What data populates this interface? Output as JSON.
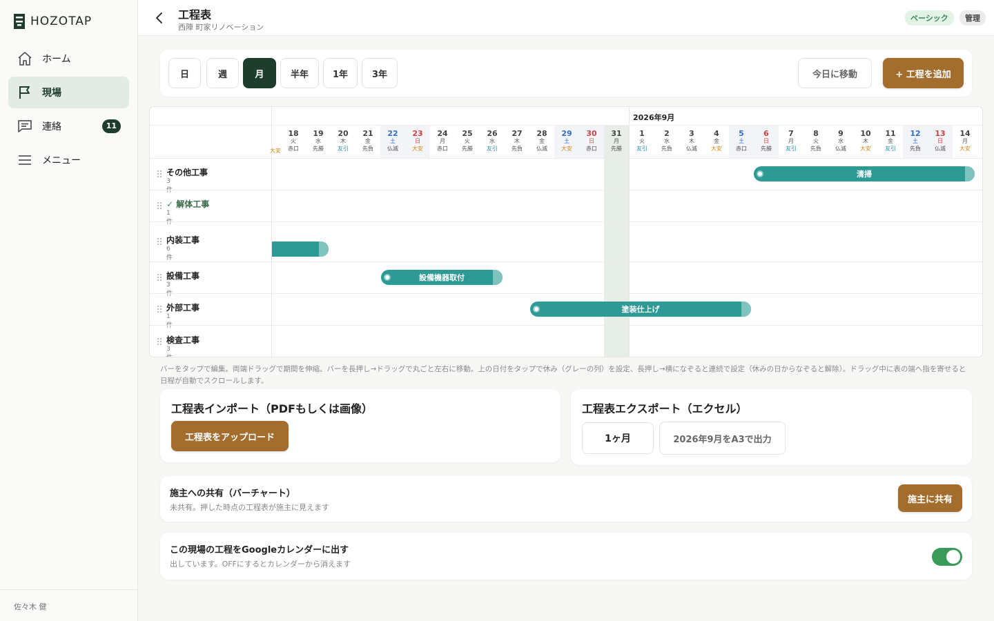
{
  "app": {
    "name": "HOZOTAP"
  },
  "colors": {
    "accent": "#1f3d2c",
    "brand_button": "#a36d2d",
    "bar": "#2e9a95",
    "toggle_on": "#3a9a5a"
  },
  "sidebar": {
    "items": [
      {
        "label": "ホーム",
        "icon": "home-icon",
        "active": false
      },
      {
        "label": "現場",
        "icon": "flag-icon",
        "active": true
      },
      {
        "label": "連絡",
        "icon": "chat-icon",
        "active": false,
        "badge": "11"
      },
      {
        "label": "メニュー",
        "icon": "menu-icon",
        "active": false
      }
    ],
    "user": "佐々木 健"
  },
  "header": {
    "title": "工程表",
    "subtitle": "西陣 町家リノベーション",
    "plan_badge": "ベーシック",
    "role_badge": "管理"
  },
  "toolbar": {
    "ranges": [
      "日",
      "週",
      "月",
      "半年",
      "1年",
      "3年"
    ],
    "selected_range": "月",
    "today_label": "今日に移動",
    "add_label": "+ 工程を追加"
  },
  "gantt": {
    "month_label": "2026年9月",
    "partial_first_rokuyo": "大安",
    "days": [
      {
        "d": "18",
        "wd": "火",
        "rk": "赤口"
      },
      {
        "d": "19",
        "wd": "水",
        "rk": "先勝"
      },
      {
        "d": "20",
        "wd": "木",
        "rk": "友引"
      },
      {
        "d": "21",
        "wd": "金",
        "rk": "先負"
      },
      {
        "d": "22",
        "wd": "土",
        "rk": "仏滅"
      },
      {
        "d": "23",
        "wd": "日",
        "rk": "大安"
      },
      {
        "d": "24",
        "wd": "月",
        "rk": "赤口"
      },
      {
        "d": "25",
        "wd": "火",
        "rk": "先勝"
      },
      {
        "d": "26",
        "wd": "水",
        "rk": "友引"
      },
      {
        "d": "27",
        "wd": "木",
        "rk": "先負"
      },
      {
        "d": "28",
        "wd": "金",
        "rk": "仏滅"
      },
      {
        "d": "29",
        "wd": "土",
        "rk": "大安"
      },
      {
        "d": "30",
        "wd": "日",
        "rk": "赤口"
      },
      {
        "d": "31",
        "wd": "月",
        "rk": "先勝"
      },
      {
        "d": "1",
        "wd": "火",
        "rk": "友引"
      },
      {
        "d": "2",
        "wd": "水",
        "rk": "先負"
      },
      {
        "d": "3",
        "wd": "木",
        "rk": "仏滅"
      },
      {
        "d": "4",
        "wd": "金",
        "rk": "大安"
      },
      {
        "d": "5",
        "wd": "土",
        "rk": "赤口"
      },
      {
        "d": "6",
        "wd": "日",
        "rk": "先勝"
      },
      {
        "d": "7",
        "wd": "月",
        "rk": "友引"
      },
      {
        "d": "8",
        "wd": "火",
        "rk": "先負"
      },
      {
        "d": "9",
        "wd": "水",
        "rk": "仏滅"
      },
      {
        "d": "10",
        "wd": "木",
        "rk": "大安"
      },
      {
        "d": "11",
        "wd": "金",
        "rk": "友引"
      },
      {
        "d": "12",
        "wd": "土",
        "rk": "先負"
      },
      {
        "d": "13",
        "wd": "日",
        "rk": "仏滅"
      },
      {
        "d": "14",
        "wd": "月",
        "rk": "大安"
      }
    ],
    "rows": [
      {
        "name": "その他工事",
        "count": "3件",
        "done": false
      },
      {
        "name": "解体工事",
        "count": "1件",
        "done": true
      },
      {
        "name": "内装工事",
        "count": "6件",
        "done": false
      },
      {
        "name": "設備工事",
        "count": "3件",
        "done": false
      },
      {
        "name": "外部工事",
        "count": "1件",
        "done": false
      },
      {
        "name": "検査工事",
        "count": "3件",
        "done": false
      }
    ],
    "bars": [
      {
        "row": 0,
        "label": "清掃",
        "start_day": "5",
        "end_day": "14"
      },
      {
        "row": 2,
        "label": "",
        "start_day": "",
        "end_day": "19"
      },
      {
        "row": 3,
        "label": "設備機器取付",
        "start_day": "22",
        "end_day": "26"
      },
      {
        "row": 4,
        "label": "塗装仕上げ",
        "start_day": "28",
        "end_day": "6"
      }
    ]
  },
  "help_text": "バーをタップで編集。両端ドラッグで期間を伸縮。バーを長押し→ドラッグで丸ごと左右に移動。上の日付をタップで休み（グレーの列）を設定、長押し→横になぞると連続で設定（休みの日からなぞると解除）。ドラッグ中に表の端へ指を寄せると日程が自動でスクロールします。",
  "import_card": {
    "title": "工程表インポート（PDFもしくは画像）",
    "button": "工程表をアップロード"
  },
  "export_card": {
    "title": "工程表エクスポート（エクセル）",
    "period": "1ヶ月",
    "button": "2026年9月をA3で出力"
  },
  "share_card": {
    "title": "施主への共有（バーチャート）",
    "subtitle": "未共有。押した時点の工程表が施主に見えます",
    "button": "施主に共有"
  },
  "gcal_card": {
    "title": "この現場の工程をGoogleカレンダーに出す",
    "subtitle": "出しています。OFFにするとカレンダーから消えます",
    "enabled": true
  }
}
